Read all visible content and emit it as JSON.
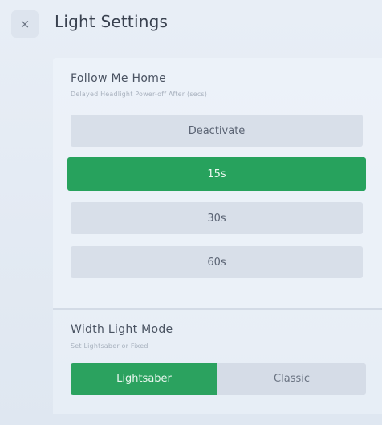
{
  "header": {
    "close_icon": "×",
    "title": "Light Settings"
  },
  "follow_me_home": {
    "title": "Follow Me Home",
    "subtitle": "Delayed Headlight Power-off After (secs)",
    "options": [
      {
        "label": "Deactivate",
        "selected": false
      },
      {
        "label": "15s",
        "selected": true
      },
      {
        "label": "30s",
        "selected": false
      },
      {
        "label": "60s",
        "selected": false
      }
    ]
  },
  "width_light_mode": {
    "title": "Width Light Mode",
    "subtitle": "Set Lightsaber or Fixed",
    "options": [
      {
        "label": "Lightsaber",
        "selected": true
      },
      {
        "label": "Classic",
        "selected": false
      }
    ]
  },
  "colors": {
    "accent": "#27a25d",
    "background": "#e6ecf4",
    "option_bg": "#d8dfe9"
  }
}
